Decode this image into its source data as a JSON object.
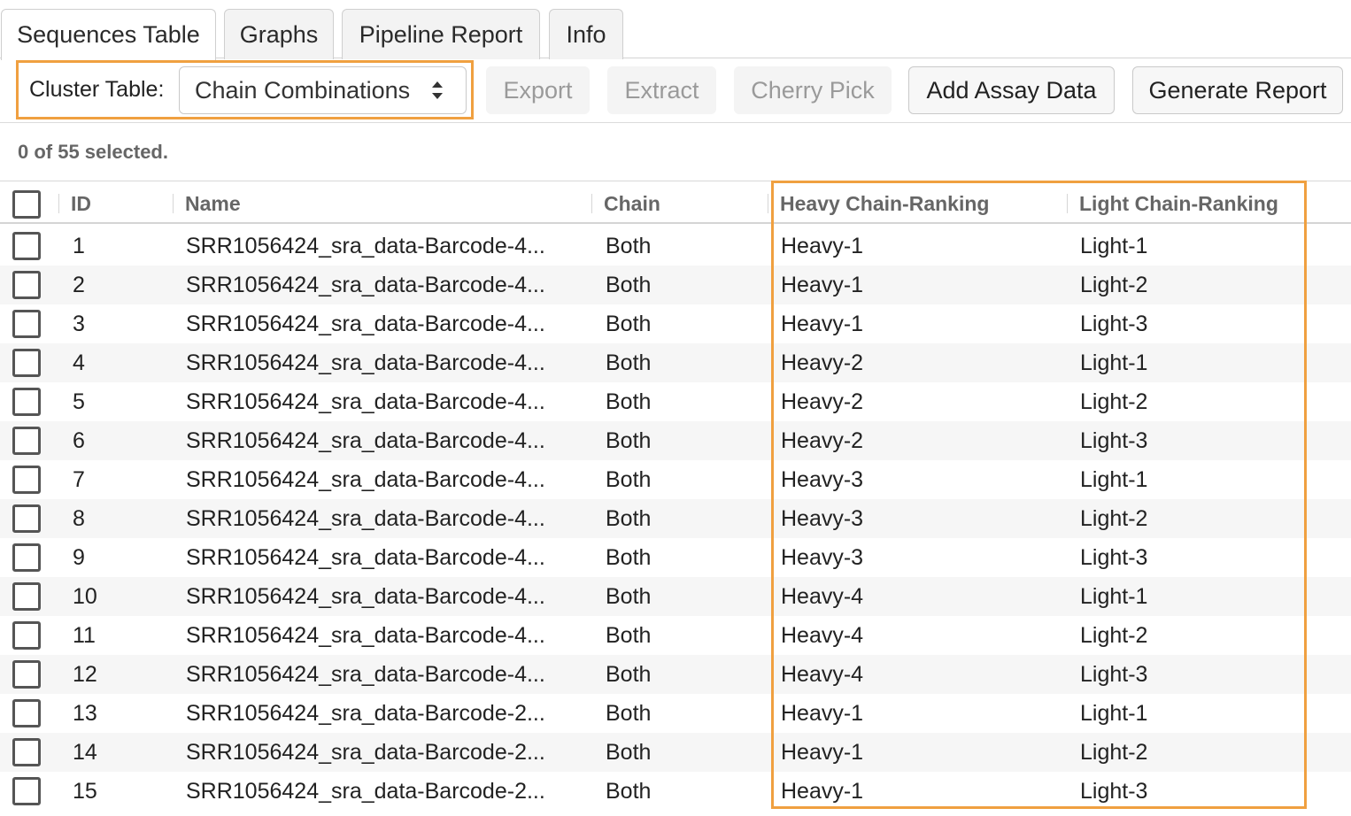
{
  "tabs": [
    {
      "label": "Sequences Table",
      "active": true
    },
    {
      "label": "Graphs",
      "active": false
    },
    {
      "label": "Pipeline Report",
      "active": false
    },
    {
      "label": "Info",
      "active": false
    }
  ],
  "toolbar": {
    "cluster_label": "Cluster Table:",
    "cluster_select_value": "Chain Combinations",
    "export_label": "Export",
    "extract_label": "Extract",
    "cherry_pick_label": "Cherry Pick",
    "add_assay_label": "Add Assay Data",
    "generate_report_label": "Generate Report"
  },
  "selection_status": "0 of 55 selected.",
  "highlight_color": "#f0a040",
  "table": {
    "columns": [
      "ID",
      "Name",
      "Chain",
      "Heavy Chain-Ranking",
      "Light Chain-Ranking"
    ],
    "rows": [
      {
        "id": "1",
        "name": "SRR1056424_sra_data-Barcode-4...",
        "chain": "Both",
        "heavy": "Heavy-1",
        "light": "Light-1"
      },
      {
        "id": "2",
        "name": "SRR1056424_sra_data-Barcode-4...",
        "chain": "Both",
        "heavy": "Heavy-1",
        "light": "Light-2"
      },
      {
        "id": "3",
        "name": "SRR1056424_sra_data-Barcode-4...",
        "chain": "Both",
        "heavy": "Heavy-1",
        "light": "Light-3"
      },
      {
        "id": "4",
        "name": "SRR1056424_sra_data-Barcode-4...",
        "chain": "Both",
        "heavy": "Heavy-2",
        "light": "Light-1"
      },
      {
        "id": "5",
        "name": "SRR1056424_sra_data-Barcode-4...",
        "chain": "Both",
        "heavy": "Heavy-2",
        "light": "Light-2"
      },
      {
        "id": "6",
        "name": "SRR1056424_sra_data-Barcode-4...",
        "chain": "Both",
        "heavy": "Heavy-2",
        "light": "Light-3"
      },
      {
        "id": "7",
        "name": "SRR1056424_sra_data-Barcode-4...",
        "chain": "Both",
        "heavy": "Heavy-3",
        "light": "Light-1"
      },
      {
        "id": "8",
        "name": "SRR1056424_sra_data-Barcode-4...",
        "chain": "Both",
        "heavy": "Heavy-3",
        "light": "Light-2"
      },
      {
        "id": "9",
        "name": "SRR1056424_sra_data-Barcode-4...",
        "chain": "Both",
        "heavy": "Heavy-3",
        "light": "Light-3"
      },
      {
        "id": "10",
        "name": "SRR1056424_sra_data-Barcode-4...",
        "chain": "Both",
        "heavy": "Heavy-4",
        "light": "Light-1"
      },
      {
        "id": "11",
        "name": "SRR1056424_sra_data-Barcode-4...",
        "chain": "Both",
        "heavy": "Heavy-4",
        "light": "Light-2"
      },
      {
        "id": "12",
        "name": "SRR1056424_sra_data-Barcode-4...",
        "chain": "Both",
        "heavy": "Heavy-4",
        "light": "Light-3"
      },
      {
        "id": "13",
        "name": "SRR1056424_sra_data-Barcode-2...",
        "chain": "Both",
        "heavy": "Heavy-1",
        "light": "Light-1"
      },
      {
        "id": "14",
        "name": "SRR1056424_sra_data-Barcode-2...",
        "chain": "Both",
        "heavy": "Heavy-1",
        "light": "Light-2"
      },
      {
        "id": "15",
        "name": "SRR1056424_sra_data-Barcode-2...",
        "chain": "Both",
        "heavy": "Heavy-1",
        "light": "Light-3"
      }
    ]
  }
}
